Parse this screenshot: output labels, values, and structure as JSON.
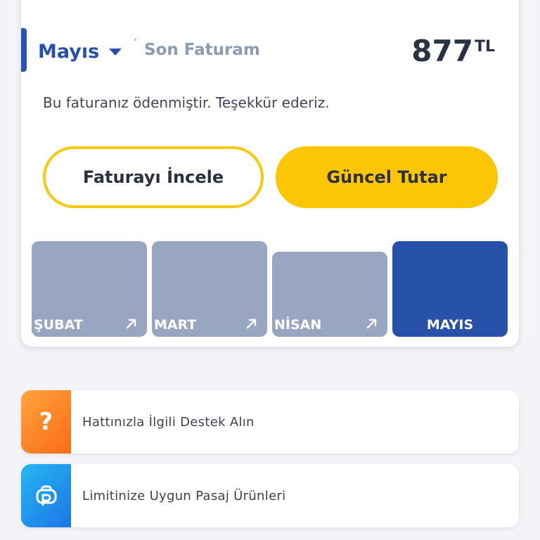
{
  "bill": {
    "selected_month": "Mayıs",
    "last_bill_label": "Son Faturam",
    "amount": "877",
    "currency": "TL",
    "status_text": "Bu faturanız ödenmiştir. Teşekkür ederiz."
  },
  "buttons": {
    "view_bill": "Faturayı İncele",
    "current_amount": "Güncel Tutar"
  },
  "months": [
    {
      "label": "ŞUBAT",
      "active": false
    },
    {
      "label": "MART",
      "active": false
    },
    {
      "label": "NİSAN",
      "active": false
    },
    {
      "label": "MAYIS",
      "active": true
    }
  ],
  "actions": [
    {
      "label": "Hattınızla İlgili Destek Alın",
      "icon": "question-icon",
      "color": "#f97c1f"
    },
    {
      "label": "Limitinize Uygun Pasaj Ürünleri",
      "icon": "pasaj-icon",
      "color": "#1f8ff0"
    }
  ],
  "colors": {
    "brand_blue": "#2852aa",
    "accent_yellow": "#fcc606",
    "inactive_month": "#98a6c1"
  }
}
